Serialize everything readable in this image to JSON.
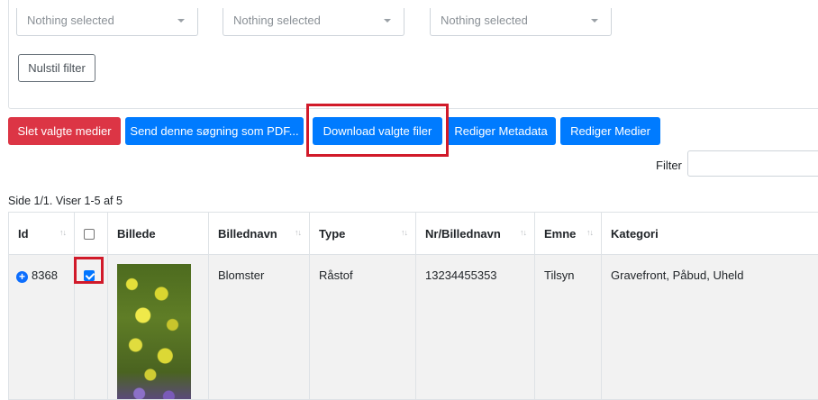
{
  "filters": {
    "select_1": "Nothing selected",
    "select_2": "Nothing selected",
    "select_3": "Nothing selected",
    "reset_label": "Nulstil filter"
  },
  "actions": {
    "delete_label": "Slet valgte medier",
    "send_pdf_label": "Send denne søgning som PDF...",
    "download_label": "Download valgte filer",
    "edit_metadata_label": "Rediger Metadata",
    "edit_media_label": "Rediger Medier"
  },
  "search": {
    "label": "Filter",
    "value": ""
  },
  "pagination": {
    "info": "Side 1/1. Viser 1-5 af 5"
  },
  "table": {
    "headers": [
      "Id",
      "",
      "Billede",
      "Billednavn",
      "Type",
      "Nr/Billednavn",
      "Emne",
      "Kategori"
    ],
    "rows": [
      {
        "id": "8368",
        "checked": true,
        "billednavn": "Blomster",
        "type": "Råstof",
        "nr": "13234455353",
        "emne": "Tilsyn",
        "kategori": "Gravefront, Påbud, Uheld"
      }
    ]
  },
  "colors": {
    "danger": "#dc3545",
    "primary": "#007bff",
    "highlight": "#d11a2a"
  },
  "icons": {
    "expand": "plus-circle-icon",
    "sort": "sort-arrows-icon",
    "dropdown": "caret-down-icon"
  }
}
